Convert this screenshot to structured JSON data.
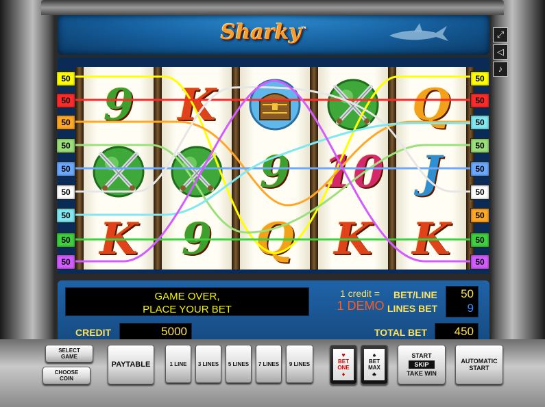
{
  "game": {
    "title": "Sharky",
    "trademark": "™"
  },
  "window_controls": [
    {
      "name": "fullscreen-icon",
      "glyph": "⤢"
    },
    {
      "name": "sound-icon",
      "glyph": "🔈"
    },
    {
      "name": "music-icon",
      "glyph": "♪"
    }
  ],
  "paylines_left": [
    {
      "label": "50",
      "color": "#ffff00"
    },
    {
      "label": "50",
      "color": "#ff2b2b"
    },
    {
      "label": "50",
      "color": "#ffa726"
    },
    {
      "label": "50",
      "color": "#9be07a"
    },
    {
      "label": "50",
      "color": "#6aa9ff"
    },
    {
      "label": "50",
      "color": "#ffffff"
    },
    {
      "label": "50",
      "color": "#7fe8f2"
    },
    {
      "label": "50",
      "color": "#3fcf3f"
    },
    {
      "label": "50",
      "color": "#d25cff"
    }
  ],
  "paylines_right": [
    {
      "label": "50",
      "color": "#ffff00"
    },
    {
      "label": "50",
      "color": "#ff2b2b"
    },
    {
      "label": "50",
      "color": "#7fe8f2"
    },
    {
      "label": "50",
      "color": "#9be07a"
    },
    {
      "label": "50",
      "color": "#6aa9ff"
    },
    {
      "label": "50",
      "color": "#ffffff"
    },
    {
      "label": "50",
      "color": "#ffa726"
    },
    {
      "label": "50",
      "color": "#3fcf3f"
    },
    {
      "label": "50",
      "color": "#d25cff"
    }
  ],
  "reels": [
    [
      "9",
      "swords",
      "K"
    ],
    [
      "K",
      "swords",
      "9"
    ],
    [
      "chest",
      "9",
      "Q"
    ],
    [
      "swords",
      "10",
      "K"
    ],
    [
      "Q",
      "J",
      "K"
    ]
  ],
  "status": {
    "message_line1": "GAME OVER,",
    "message_line2": "PLACE YOUR BET"
  },
  "credit_rate": {
    "label": "1 credit =",
    "value": "1 DEMO"
  },
  "bet": {
    "bet_line_label": "BET/LINE",
    "bet_line_value": "50",
    "lines_bet_label": "LINES BET",
    "lines_bet_value": "9",
    "total_bet_label": "TOTAL BET",
    "total_bet_value": "450"
  },
  "credit": {
    "label": "CREDIT",
    "value": "5000"
  },
  "buttons": {
    "select_game": "SELECT GAME",
    "choose_coin": "CHOOSE COIN",
    "paytable": "PAYTABLE",
    "line1": "1 LINE",
    "lines3": "3 LINES",
    "lines5": "5 LINES",
    "lines7": "7 LINES",
    "lines9": "9 LINES",
    "bet_one": "BET ONE",
    "bet_max": "BET MAX",
    "start": "START",
    "skip": "SKIP",
    "take_win": "TAKE WIN",
    "automatic_start": "AUTOMATIC START"
  }
}
